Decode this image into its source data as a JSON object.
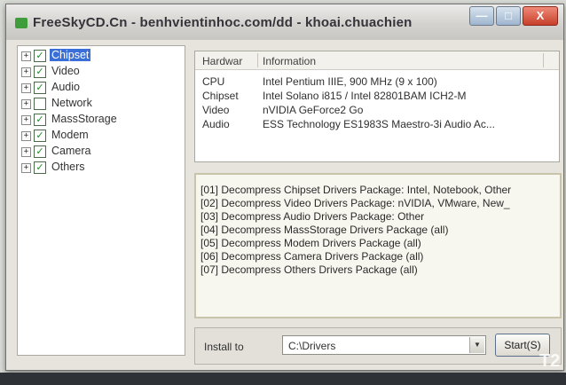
{
  "window": {
    "title": "FreeSkyCD.Cn - benhvientinhoc.com/dd - khoai.chuachien",
    "minimize_symbol": "—",
    "maximize_symbol": "□",
    "close_symbol": "X"
  },
  "tree": {
    "items": [
      {
        "label": "Chipset",
        "checked": true,
        "selected": true
      },
      {
        "label": "Video",
        "checked": true,
        "selected": false
      },
      {
        "label": "Audio",
        "checked": true,
        "selected": false
      },
      {
        "label": "Network",
        "checked": false,
        "selected": false
      },
      {
        "label": "MassStorage",
        "checked": true,
        "selected": false
      },
      {
        "label": "Modem",
        "checked": true,
        "selected": false
      },
      {
        "label": "Camera",
        "checked": true,
        "selected": false
      },
      {
        "label": "Others",
        "checked": true,
        "selected": false
      }
    ],
    "expander_symbol": "+",
    "check_symbol": "✓"
  },
  "info": {
    "headers": [
      "Hardwar",
      "Information"
    ],
    "rows": [
      {
        "hardware": "CPU",
        "information": "Intel Pentium IIIE, 900 MHz (9 x 100)"
      },
      {
        "hardware": "Chipset",
        "information": "Intel Solano i815 / Intel 82801BAM ICH2-M"
      },
      {
        "hardware": "Video",
        "information": "nVIDIA GeForce2 Go"
      },
      {
        "hardware": "Audio",
        "information": "ESS Technology ES1983S Maestro-3i Audio Ac..."
      }
    ]
  },
  "log": {
    "lines": [
      "[01] Decompress Chipset Drivers Package: Intel, Notebook, Other",
      "[02] Decompress Video Drivers Package: nVIDIA, VMware, New_",
      "[03] Decompress Audio Drivers Package: Other",
      "[04] Decompress MassStorage Drivers Package (all)",
      "[05] Decompress Modem Drivers Package (all)",
      "[06] Decompress Camera Drivers Package (all)",
      "[07] Decompress Others Drivers Package (all)"
    ]
  },
  "install": {
    "label": "Install to",
    "path": "C:\\Drivers",
    "combo_arrow": "▼",
    "start_label": "Start(S)"
  },
  "watermark": "T2"
}
